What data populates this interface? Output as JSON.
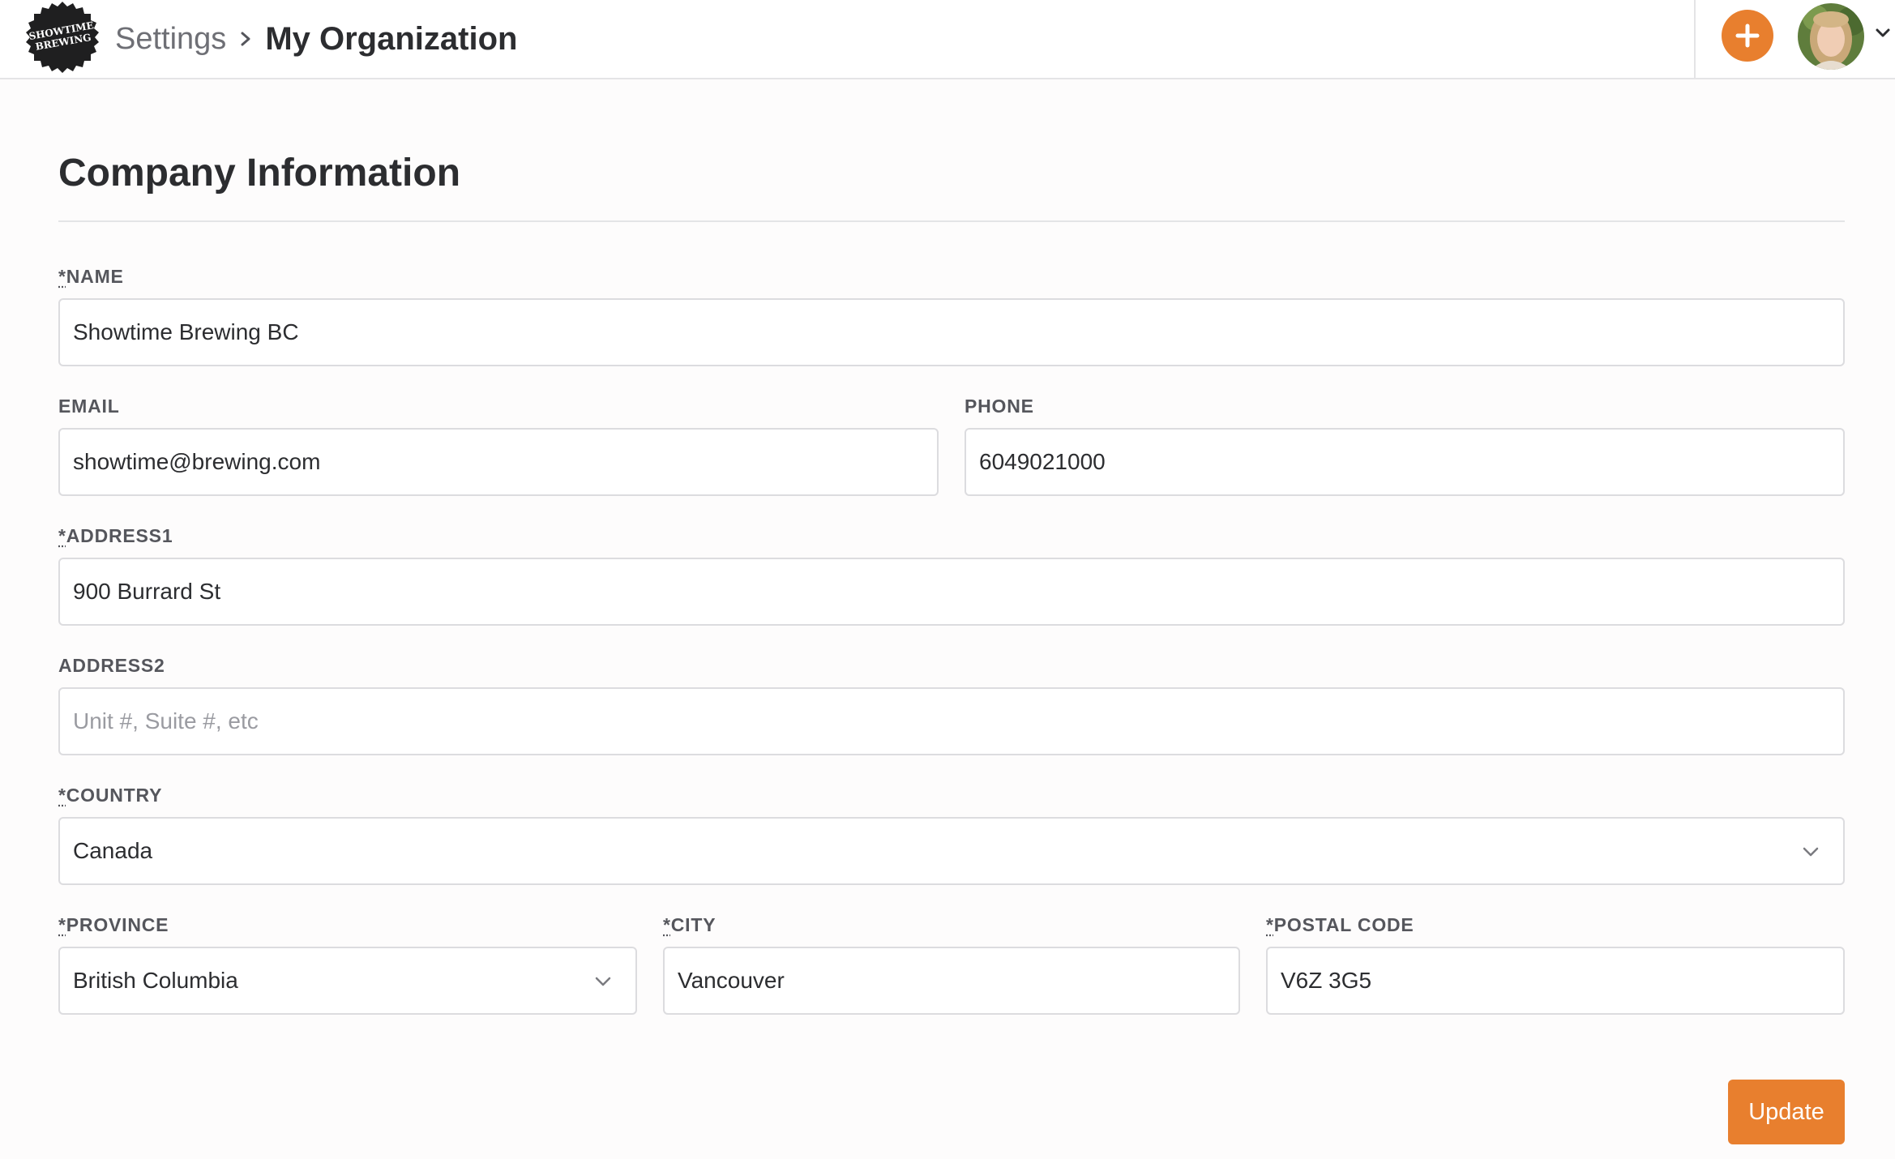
{
  "header": {
    "logo_text_line1": "SHOWTIME",
    "logo_text_line2": "BREWING",
    "breadcrumb": {
      "parent": "Settings",
      "current": "My Organization"
    },
    "add_icon": "plus-icon",
    "avatar_icon": "user-avatar",
    "menu_icon": "chevron-down-icon"
  },
  "section": {
    "title": "Company Information"
  },
  "form": {
    "required_marker": "*",
    "name": {
      "label": "NAME",
      "value": "Showtime Brewing BC"
    },
    "email": {
      "label": "EMAIL",
      "value": "showtime@brewing.com"
    },
    "phone": {
      "label": "PHONE",
      "value": "6049021000"
    },
    "address1": {
      "label": "ADDRESS1",
      "value": "900 Burrard St"
    },
    "address2": {
      "label": "ADDRESS2",
      "value": "",
      "placeholder": "Unit #, Suite #, etc"
    },
    "country": {
      "label": "COUNTRY",
      "value": "Canada"
    },
    "province": {
      "label": "PROVINCE",
      "value": "British Columbia"
    },
    "city": {
      "label": "CITY",
      "value": "Vancouver"
    },
    "postal_code": {
      "label": "POSTAL CODE",
      "value": "V6Z 3G5"
    },
    "update_label": "Update"
  },
  "colors": {
    "accent": "#e87f2e",
    "border": "#dcdcdf",
    "text": "#2c2d30",
    "muted": "#6e6f75"
  }
}
